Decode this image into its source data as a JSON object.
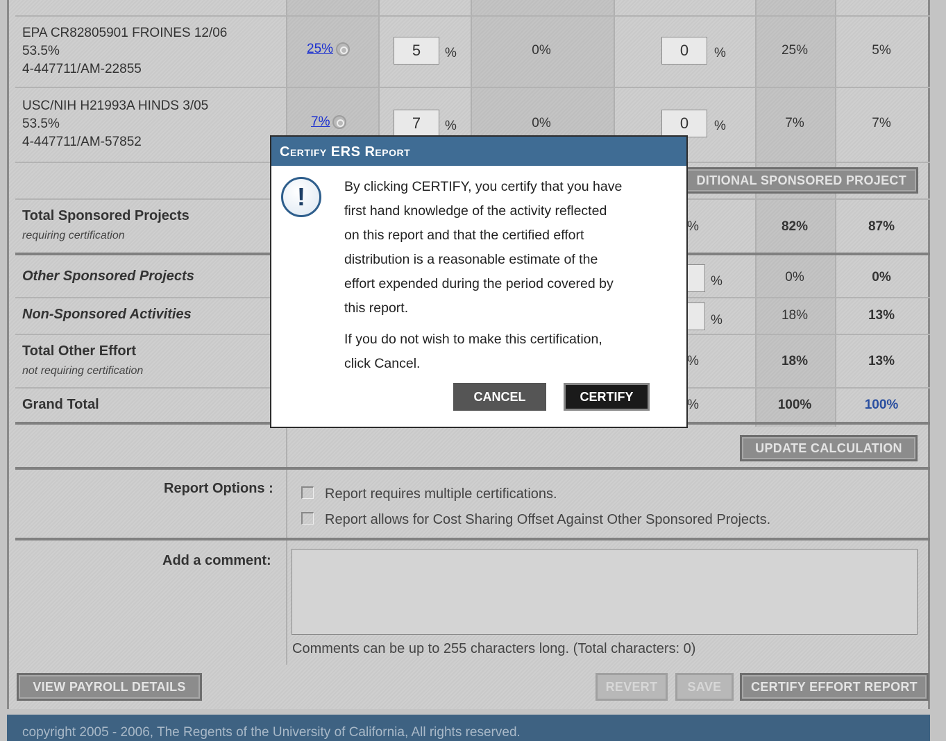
{
  "projects": [
    {
      "line1": "EPA CR82805901 FROINES 12/06",
      "line2": "53.5%",
      "line3": "4-447711/AM-22855",
      "link_pct": "25%",
      "input1": "5",
      "mid_pct": "0%",
      "input2": "0",
      "col7": "25%",
      "col8": "5%"
    },
    {
      "line1": "USC/NIH H21993A HINDS 3/05",
      "line2": "53.5%",
      "line3": "4-447711/AM-57852",
      "link_pct": "7%",
      "input1": "7",
      "mid_pct": "0%",
      "input2": "0",
      "col7": "7%",
      "col8": "7%"
    }
  ],
  "pct_sign": "%",
  "add_project_label": "DITIONAL SPONSORED PROJECT",
  "totals": {
    "sponsored": {
      "label": "Total Sponsored Projects",
      "sub": "requiring certification",
      "partial": "%",
      "col7": "82%",
      "col8": "87%"
    },
    "other": {
      "label": "Other Sponsored Projects",
      "col7": "0%",
      "col8": "0%"
    },
    "nonsponsored": {
      "label": "Non-Sponsored Activities",
      "col7": "18%",
      "col8": "13%"
    },
    "other_effort": {
      "label": "Total Other Effort",
      "sub": "not requiring certification",
      "partial": "%",
      "col7": "18%",
      "col8": "13%"
    },
    "grand": {
      "label": "Grand Total",
      "partial": "%",
      "col7": "100%",
      "col8": "100%"
    }
  },
  "update_button": "UPDATE CALCULATION",
  "report_options": {
    "label": "Report Options :",
    "option1": "Report requires multiple certifications.",
    "option2": "Report allows for Cost Sharing Offset Against Other Sponsored Projects."
  },
  "comment": {
    "label": "Add a comment:",
    "value": "",
    "hint": "Comments can be up to 255 characters long. (Total characters: 0)"
  },
  "bottom_buttons": {
    "view_payroll": "VIEW PAYROLL DETAILS",
    "revert": "REVERT",
    "save": "SAVE",
    "certify_report": "CERTIFY EFFORT REPORT"
  },
  "footer": "copyright 2005 - 2006, The Regents of the University of California, All rights reserved.",
  "modal": {
    "title": "Certify ERS Report",
    "icon": "exclamation-icon",
    "lines": [
      "By clicking CERTIFY, you certify that you have",
      "first hand knowledge of the activity reflected",
      "on this report and that the certified effort",
      "distribution is a reasonable estimate of the",
      "effort expended during the period covered by",
      "this report."
    ],
    "line7": "If you do not wish to make this certification,",
    "line8": "click Cancel.",
    "cancel": "CANCEL",
    "certify": "CERTIFY"
  },
  "colors": {
    "modal_title_bg": "#3f6c94",
    "footer_bg": "#3e6282",
    "link": "#1a2fd0",
    "grand_total_accent": "#2a4fa0"
  }
}
